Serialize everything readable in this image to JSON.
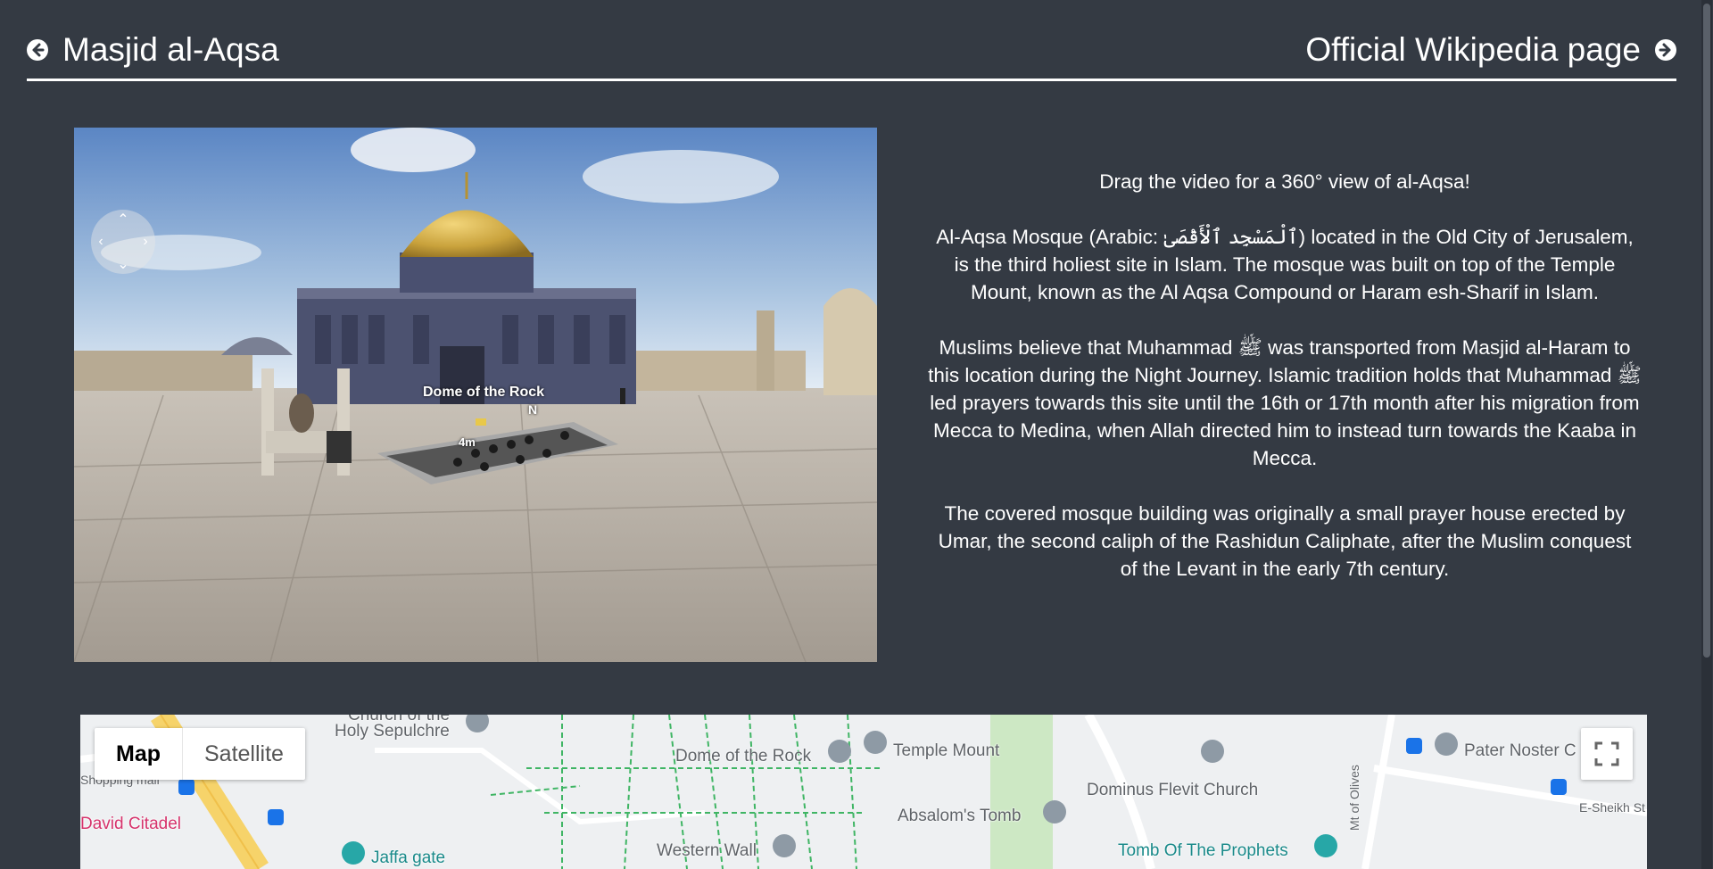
{
  "header": {
    "title": "Masjid al-Aqsa",
    "wiki_link": "Official Wikipedia page"
  },
  "video": {
    "overlay_label": "Dome of the Rock",
    "scale_label": "4m",
    "north_label": "N"
  },
  "description": {
    "intro": "Drag the video for a 360° view of al-Aqsa!",
    "p1": "Al-Aqsa Mosque (Arabic: ٱلْمَسْجِد ٱلْأَقْصَىٰ) located in the Old City of Jerusalem, is the third holiest site in Islam. The mosque was built on top of the Temple Mount, known as the Al Aqsa Compound or Haram esh-Sharif in Islam.",
    "p2": "Muslims believe that Muhammad ﷺ was transported from Masjid al-Haram to this location during the Night Journey. Islamic tradition holds that Muhammad ﷺ led prayers towards this site until the 16th or 17th month after his migration from Mecca to Medina, when Allah directed him to instead turn towards the Kaaba in Mecca.",
    "p3": "The covered mosque building was originally a small prayer house erected by Umar, the second caliph of the Rashidun Caliphate, after the Muslim conquest of the Levant in the early 7th century."
  },
  "map": {
    "tabs": [
      "Map",
      "Satellite"
    ],
    "active_tab": "Map",
    "places": {
      "holy_sepulchre_top": "Church of the",
      "holy_sepulchre": "Holy Sepulchre",
      "shopping_mall": "Shopping mall",
      "david_citadel": "David Citadel",
      "jaffa_gate": "Jaffa gate",
      "dome_of_the_rock": "Dome of the Rock",
      "temple_mount": "Temple Mount",
      "western_wall": "Western Wall",
      "absaloms_tomb": "Absalom's Tomb",
      "dominus_flevit": "Dominus Flevit Church",
      "tomb_prophets": "Tomb Of The Prophets",
      "pater_noster": "Pater Noster C",
      "mt_of_olives": "Mt of Olives",
      "e_sheikh": "E-Sheikh St"
    }
  },
  "colors": {
    "background": "#343a43",
    "text": "#ffffff",
    "map_bg": "#eef0f2"
  }
}
